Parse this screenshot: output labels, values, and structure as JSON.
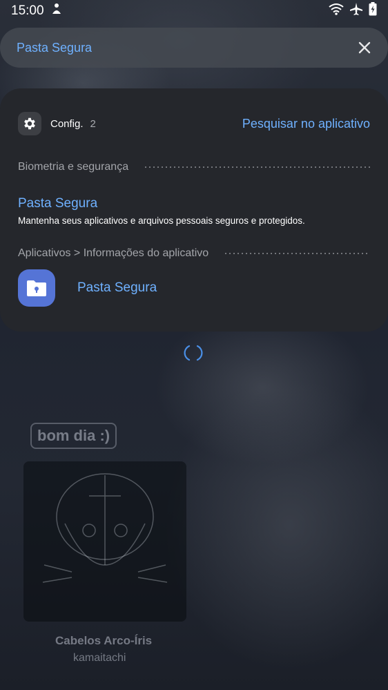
{
  "status_bar": {
    "time": "15:00"
  },
  "search": {
    "query": "Pasta Segura"
  },
  "app_result": {
    "name": "Config.",
    "count": "2",
    "search_in_app": "Pesquisar no aplicativo"
  },
  "sections": [
    {
      "path": "Biometria e segurança",
      "item_title": "Pasta Segura",
      "item_description": "Mantenha seus aplicativos e arquivos pessoais seguros e protegidos."
    },
    {
      "path": "Aplicativos > Informações do aplicativo",
      "item_title": "Pasta Segura"
    }
  ],
  "background": {
    "greeting": "bom dia :)",
    "track_title": "Cabelos Arco-Íris",
    "track_artist": "kamaitachi"
  },
  "colors": {
    "accent": "#6fb1ff",
    "card": "#25272c",
    "app_icon": "#5574d6"
  }
}
